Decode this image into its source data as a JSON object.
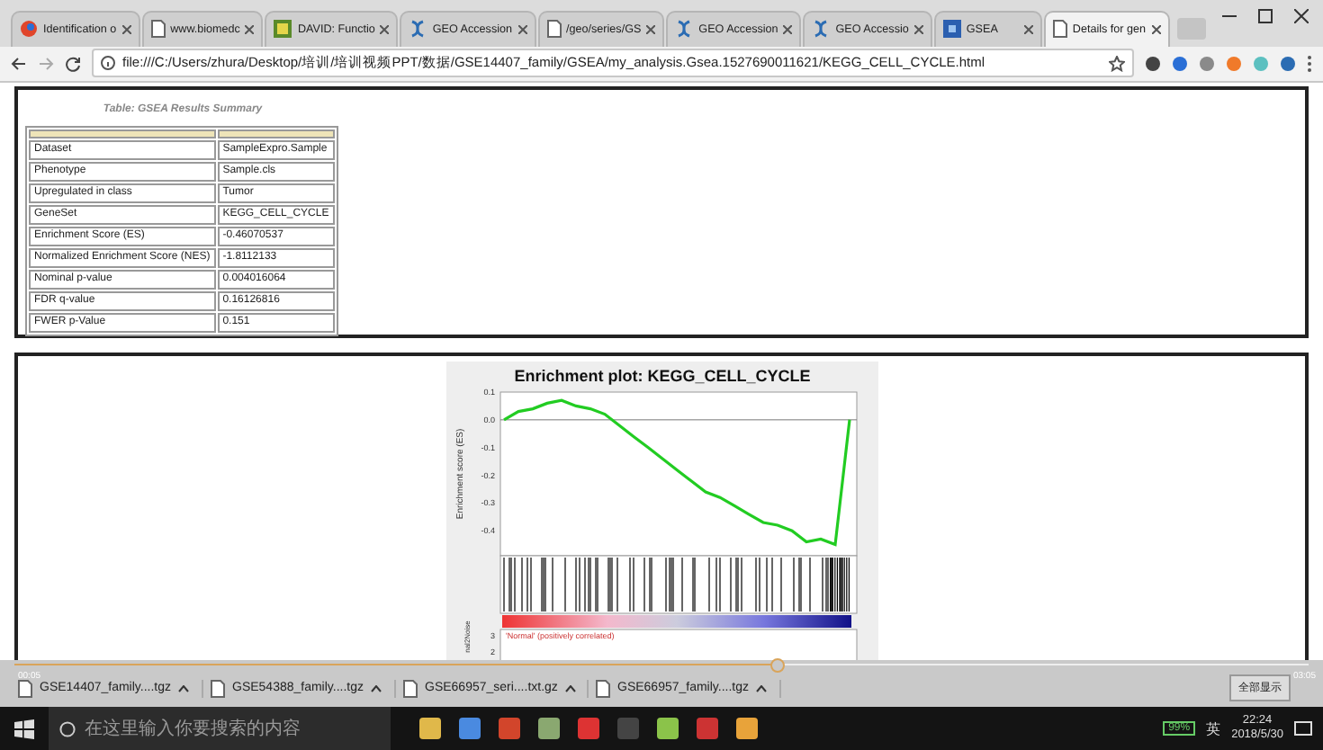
{
  "tabs": [
    {
      "label": "Identification o",
      "selected": false
    },
    {
      "label": "www.biomedc",
      "selected": false
    },
    {
      "label": "DAVID: Functio",
      "selected": false
    },
    {
      "label": "GEO Accession",
      "selected": false
    },
    {
      "label": "/geo/series/GS",
      "selected": false
    },
    {
      "label": "GEO Accession",
      "selected": false
    },
    {
      "label": "GEO Accessio",
      "selected": false
    },
    {
      "label": "GSEA",
      "selected": false
    },
    {
      "label": "Details for gen",
      "selected": true
    }
  ],
  "address_bar": {
    "url": "file:///C:/Users/zhura/Desktop/培训/培训视频PPT/数据/GSE14407_family/GSEA/my_analysis.Gsea.1527690011621/KEGG_CELL_CYCLE.html"
  },
  "summary_table": {
    "title": "Table: GSEA Results Summary",
    "rows": [
      {
        "label": "Dataset",
        "value": "SampleExpro.Sample"
      },
      {
        "label": "Phenotype",
        "value": "Sample.cls"
      },
      {
        "label": "Upregulated in class",
        "value": "Tumor"
      },
      {
        "label": "GeneSet",
        "value": "KEGG_CELL_CYCLE"
      },
      {
        "label": "Enrichment Score (ES)",
        "value": "-0.46070537"
      },
      {
        "label": "Normalized Enrichment Score (NES)",
        "value": "-1.8112133"
      },
      {
        "label": "Nominal p-value",
        "value": "0.004016064"
      },
      {
        "label": "FDR q-value",
        "value": "0.16126816"
      },
      {
        "label": "FWER p-Value",
        "value": "0.151"
      }
    ]
  },
  "enrichment_plot": {
    "chart_data": {
      "type": "line",
      "title": "Enrichment plot: KEGG_CELL_CYCLE",
      "ylabel": "Enrichment score (ES)",
      "ylim": [
        -0.49,
        0.1
      ],
      "yticks": [
        {
          "value": 0.1,
          "label": "0.1"
        },
        {
          "value": 0,
          "label": "0.0"
        },
        {
          "value": -0.1,
          "label": "-0.1"
        },
        {
          "value": -0.2,
          "label": "-0.2"
        },
        {
          "value": -0.3,
          "label": "-0.3"
        },
        {
          "value": -0.4,
          "label": "-0.4"
        }
      ],
      "series": [
        {
          "color": "#22cc22",
          "values": [
            0,
            0.03,
            0.04,
            0.06,
            0.07,
            0.05,
            0.04,
            0.02,
            -0.02,
            -0.06,
            -0.1,
            -0.14,
            -0.18,
            -0.22,
            -0.26,
            -0.28,
            -0.31,
            -0.34,
            -0.37,
            -0.38,
            -0.4,
            -0.44,
            -0.43,
            -0.45,
            0
          ]
        }
      ]
    },
    "phenotype_label": "'Normal' (positively correlated)",
    "lower_ticks": [
      "3",
      "2"
    ],
    "lower_ylabel": "nal2Noise"
  },
  "player": {
    "time_elapsed": "00:05",
    "time_total": "03:05",
    "level": 0.59
  },
  "downloads": {
    "items": [
      "GSE14407_family....tgz",
      "GSE54388_family....tgz",
      "GSE66957_seri....txt.gz",
      "GSE66957_family....tgz"
    ],
    "show_all": "全部显示"
  },
  "taskbar": {
    "search_placeholder": "在这里输入你要搜索的内容",
    "battery": "99%",
    "input_method": "英",
    "time": "22:24",
    "date": "2018/5/30"
  }
}
